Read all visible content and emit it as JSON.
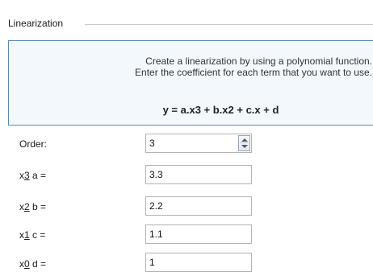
{
  "group": {
    "title": "Linearization"
  },
  "info": {
    "line1": "Create a linearization by using a polynomial function.",
    "line2": "Enter the coefficient for each term that you want to use.",
    "formula": "y = a.x3 + b.x2 + c.x + d"
  },
  "order": {
    "label": "Order:",
    "value": "3"
  },
  "coefficients": [
    {
      "prefix": "x",
      "key": "3",
      "suffix": " a =",
      "value": "3.3"
    },
    {
      "prefix": "x",
      "key": "2",
      "suffix": " b =",
      "value": "2.2"
    },
    {
      "prefix": "x",
      "key": "1",
      "suffix": " c =",
      "value": "1.1"
    },
    {
      "prefix": "x",
      "key": "0",
      "suffix": " d =",
      "value": "1"
    }
  ],
  "colors": {
    "panel_border": "#5b88b4",
    "panel_bg": "#f3f8fd"
  }
}
